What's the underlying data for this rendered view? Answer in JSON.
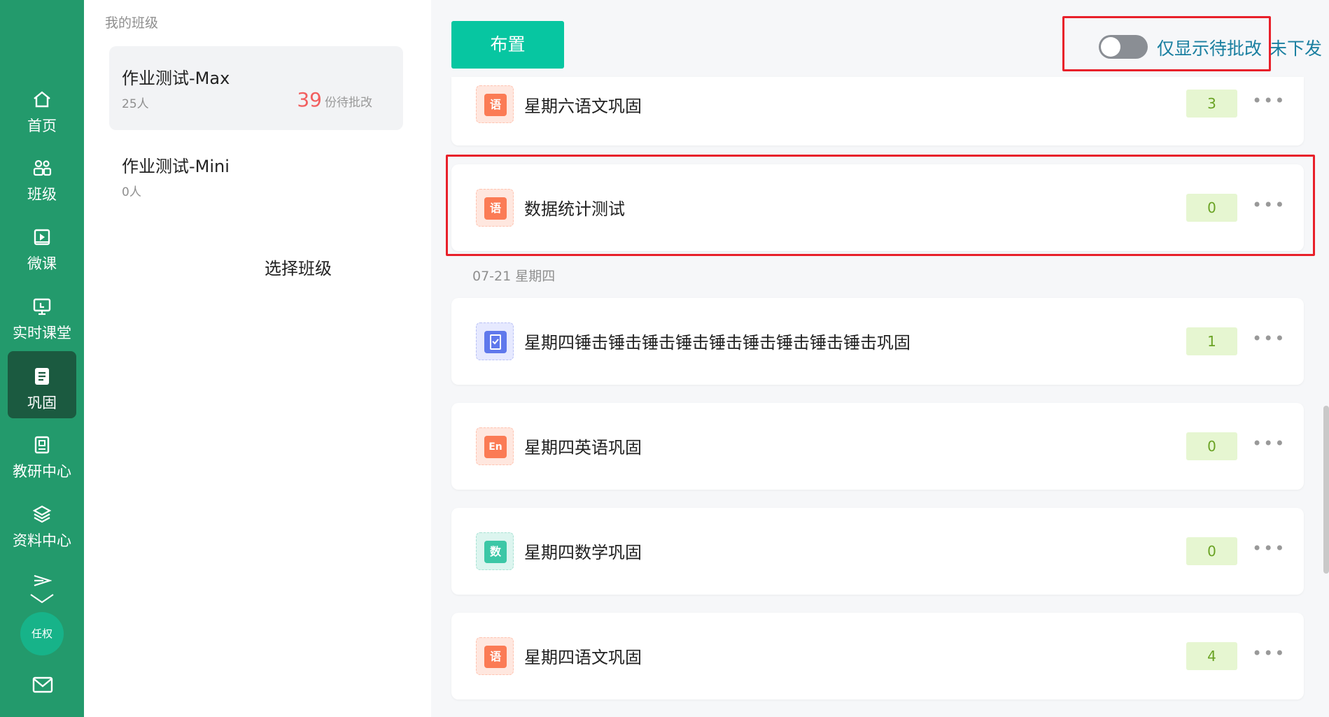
{
  "nav": {
    "items": [
      {
        "label": "首页",
        "icon": "home-icon"
      },
      {
        "label": "班级",
        "icon": "users-icon"
      },
      {
        "label": "微课",
        "icon": "video-icon"
      },
      {
        "label": "实时课堂",
        "icon": "classroom-icon"
      },
      {
        "label": "巩固",
        "icon": "notebook-icon",
        "active": true
      },
      {
        "label": "教研中心",
        "icon": "research-icon"
      },
      {
        "label": "资料中心",
        "icon": "layers-icon"
      }
    ],
    "avatar_label": "任权"
  },
  "classes": {
    "heading": "我的班级",
    "items": [
      {
        "name": "作业测试-Max",
        "count": "25人",
        "pending_num": "39",
        "pending_label": "份待批改",
        "selected": true
      },
      {
        "name": "作业测试-Mini",
        "count": "0人"
      }
    ],
    "select_prompt": "选择班级"
  },
  "toolbar": {
    "assign_label": "布置",
    "toggle_label": "仅显示待批改",
    "toggle_on": false,
    "undistributed_label": "未下发"
  },
  "date_separator": "07-21 星期四",
  "tasks": [
    {
      "subject": "语",
      "type": "yu",
      "title": "星期六语文巩固",
      "count": "3"
    },
    {
      "subject": "语",
      "type": "yu",
      "title": "数据统计测试",
      "count": "0"
    },
    {
      "subject": "book",
      "type": "book",
      "title": "星期四锤击锤击锤击锤击锤击锤击锤击锤击锤击巩固",
      "count": "1"
    },
    {
      "subject": "En",
      "type": "en",
      "title": "星期四英语巩固",
      "count": "0"
    },
    {
      "subject": "数",
      "type": "shu",
      "title": "星期四数学巩固",
      "count": "0"
    },
    {
      "subject": "语",
      "type": "yu",
      "title": "星期四语文巩固",
      "count": "4"
    }
  ],
  "more_glyph": "•••",
  "colors": {
    "nav_bg": "#239a6c",
    "accent": "#07c6a1",
    "highlight": "#e8202a",
    "pending": "#f25f5f"
  }
}
